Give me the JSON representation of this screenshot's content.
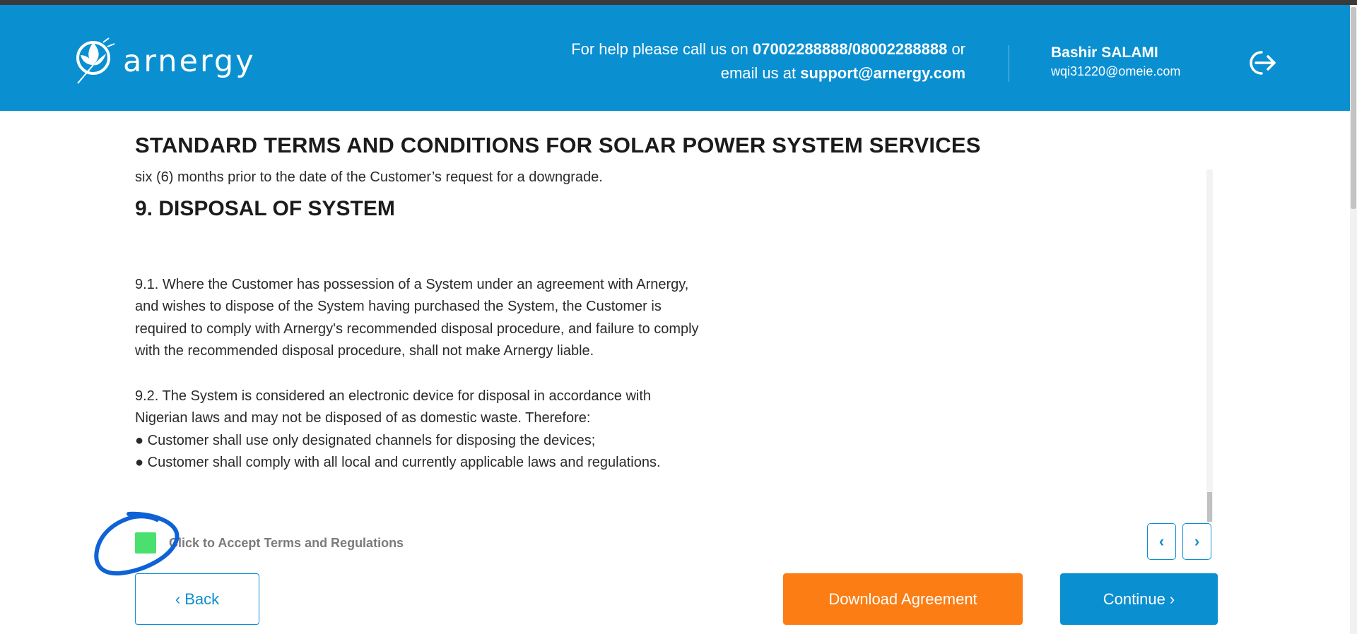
{
  "brand": {
    "name": "arnergy"
  },
  "header": {
    "help_prefix": "For help please call us on",
    "phone": "07002288888/08002288888",
    "help_or": "or",
    "email_prefix": "email us at",
    "support_email": "support@arnergy.com"
  },
  "user": {
    "name": "Bashir SALAMI",
    "email": "wqi31220@omeie.com"
  },
  "icons": {
    "logout": "logout-icon",
    "logo": "arnergy-logo-icon"
  },
  "document": {
    "title": "STANDARD TERMS AND CONDITIONS FOR SOLAR POWER SYSTEM SERVICES",
    "prev_line": "six (6) months prior to the date of the Customer’s request for a downgrade.",
    "section_heading": "9. DISPOSAL OF SYSTEM",
    "para_9_1": "9.1. Where the Customer has possession of a System under an agreement with Arnergy, and wishes to dispose of the System having purchased the System, the Customer is required to comply with Arnergy's recommended disposal procedure, and failure to comply with the recommended disposal procedure, shall not make Arnergy liable.",
    "para_9_2": "9.2. The System is considered an electronic device for disposal in accordance with Nigerian laws and may not be disposed of as domestic waste. Therefore:",
    "bullet_1": "● Customer shall use only designated channels for disposing the devices;",
    "bullet_2": "● Customer shall comply with all local and currently applicable laws and regulations."
  },
  "accept": {
    "label": "Click to Accept Terms and Regulations",
    "checked_color": "#4ae06e"
  },
  "pager": {
    "prev": "‹",
    "next": "›"
  },
  "buttons": {
    "back": "‹ Back",
    "download": "Download Agreement",
    "continue": "Continue ›"
  },
  "colors": {
    "primary": "#0a8fd1",
    "accent": "#fb7d14",
    "annotation": "#0e62d6"
  }
}
